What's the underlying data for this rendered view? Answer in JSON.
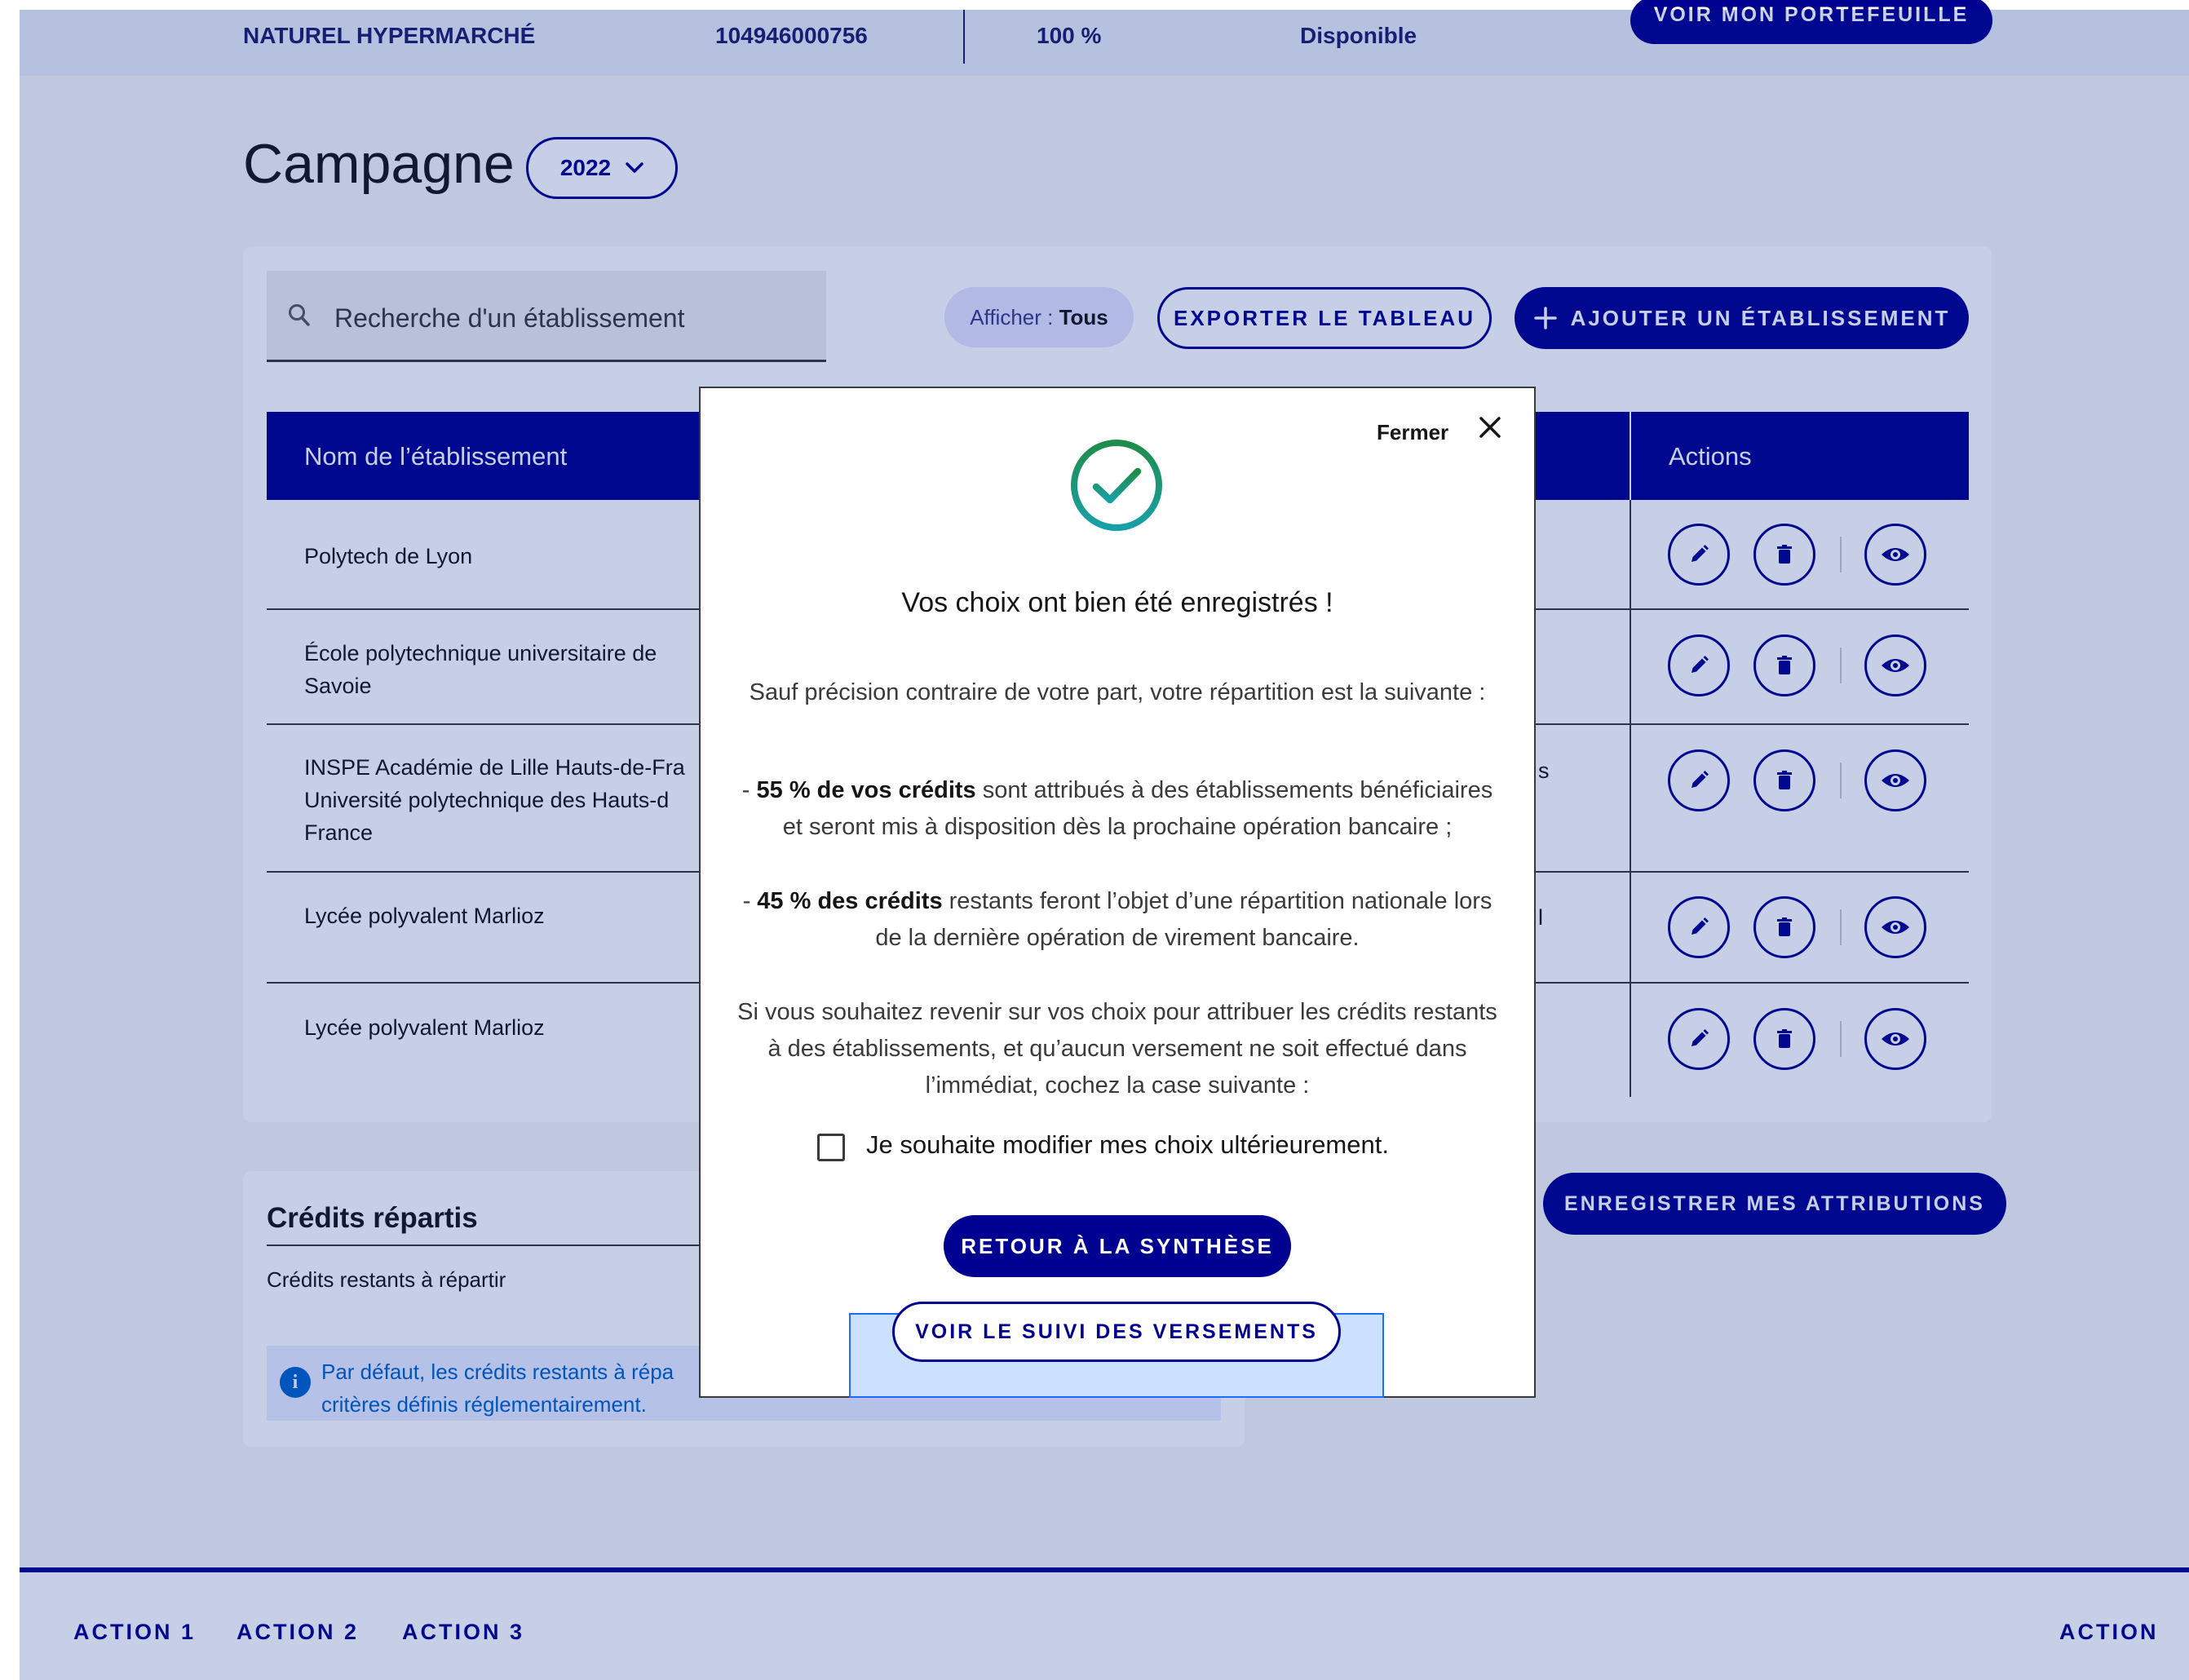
{
  "topbar": {
    "establishment_name": "NATUREL HYPERMARCHÉ",
    "id_number": "104946000756",
    "percent": "100 %",
    "status": "Disponible",
    "wallet_button": "VOIR MON PORTEFEUILLE"
  },
  "campaign": {
    "title": "Campagne",
    "year": "2022"
  },
  "toolbar": {
    "search_placeholder": "Recherche d'un établissement",
    "filter_label": "Afficher : ",
    "filter_value": "Tous",
    "export_button": "EXPORTER LE TABLEAU",
    "add_button": "AJOUTER UN ÉTABLISSEMENT"
  },
  "table": {
    "columns": [
      "Nom de l’établissement",
      "Actions"
    ],
    "rows": [
      {
        "name_line1": "Polytech de Lyon",
        "name_line2": "",
        "name_line3": "",
        "fragment": ""
      },
      {
        "name_line1": "École polytechnique universitaire de",
        "name_line2": "Savoie",
        "name_line3": "",
        "fragment": ""
      },
      {
        "name_line1": "INSPE Académie de Lille Hauts-de-Fra",
        "name_line2": "Université polytechnique des Hauts-d",
        "name_line3": "France",
        "fragment": "s"
      },
      {
        "name_line1": "Lycée polyvalent Marlioz",
        "name_line2": "",
        "name_line3": "",
        "fragment": "l"
      },
      {
        "name_line1": "Lycée polyvalent Marlioz",
        "name_line2": "",
        "name_line3": "",
        "fragment": ""
      }
    ]
  },
  "credits": {
    "title": "Crédits répartis",
    "subtitle": "Crédits restants à répartir",
    "info_line1": "Par défaut, les crédits restants à répa",
    "info_line2": "critères définis réglementairement.",
    "save_button": "ENREGISTRER MES ATTRIBUTIONS"
  },
  "footer": {
    "links": [
      "ACTION 1",
      "ACTION 2",
      "ACTION 3"
    ],
    "right_link": "ACTION"
  },
  "modal": {
    "close_label": "Fermer",
    "title": "Vos choix ont bien été enregistrés !",
    "intro": "Sauf précision contraire de votre part, votre répartition est la suivante :",
    "item1_bold": "55 % de vos crédits",
    "item1_text": " sont attribués à des établissements bénéficiaires et seront mis à disposition dès la prochaine opération bancaire ;",
    "item2_bold": "45 % des crédits",
    "item2_text": " restants feront l’objet d’une répartition nationale lors de la dernière opération de virement bancaire.",
    "dash": "- ",
    "note": "Si vous souhaitez revenir sur vos choix pour attribuer les crédits restants à des établissements, et qu’aucun versement ne soit effectué dans l’immédiat, cochez la case suivante :",
    "checkbox_label": "Je souhaite modifier mes choix ultérieurement.",
    "back_button": "RETOUR À LA SYNTHÈSE",
    "tracking_button": "VOIR LE SUIVI DES VERSEMENTS"
  },
  "colors": {
    "primary": "#000091",
    "success": "#1f8d49",
    "info": "#0063cb"
  },
  "icons": {
    "search": "search-icon",
    "add": "plus-icon",
    "close": "close-icon",
    "success": "check-circle-icon",
    "edit": "pencil-icon",
    "delete": "trash-icon",
    "view": "eye-icon",
    "info": "info-icon",
    "dropdown": "chevron-down-icon"
  }
}
